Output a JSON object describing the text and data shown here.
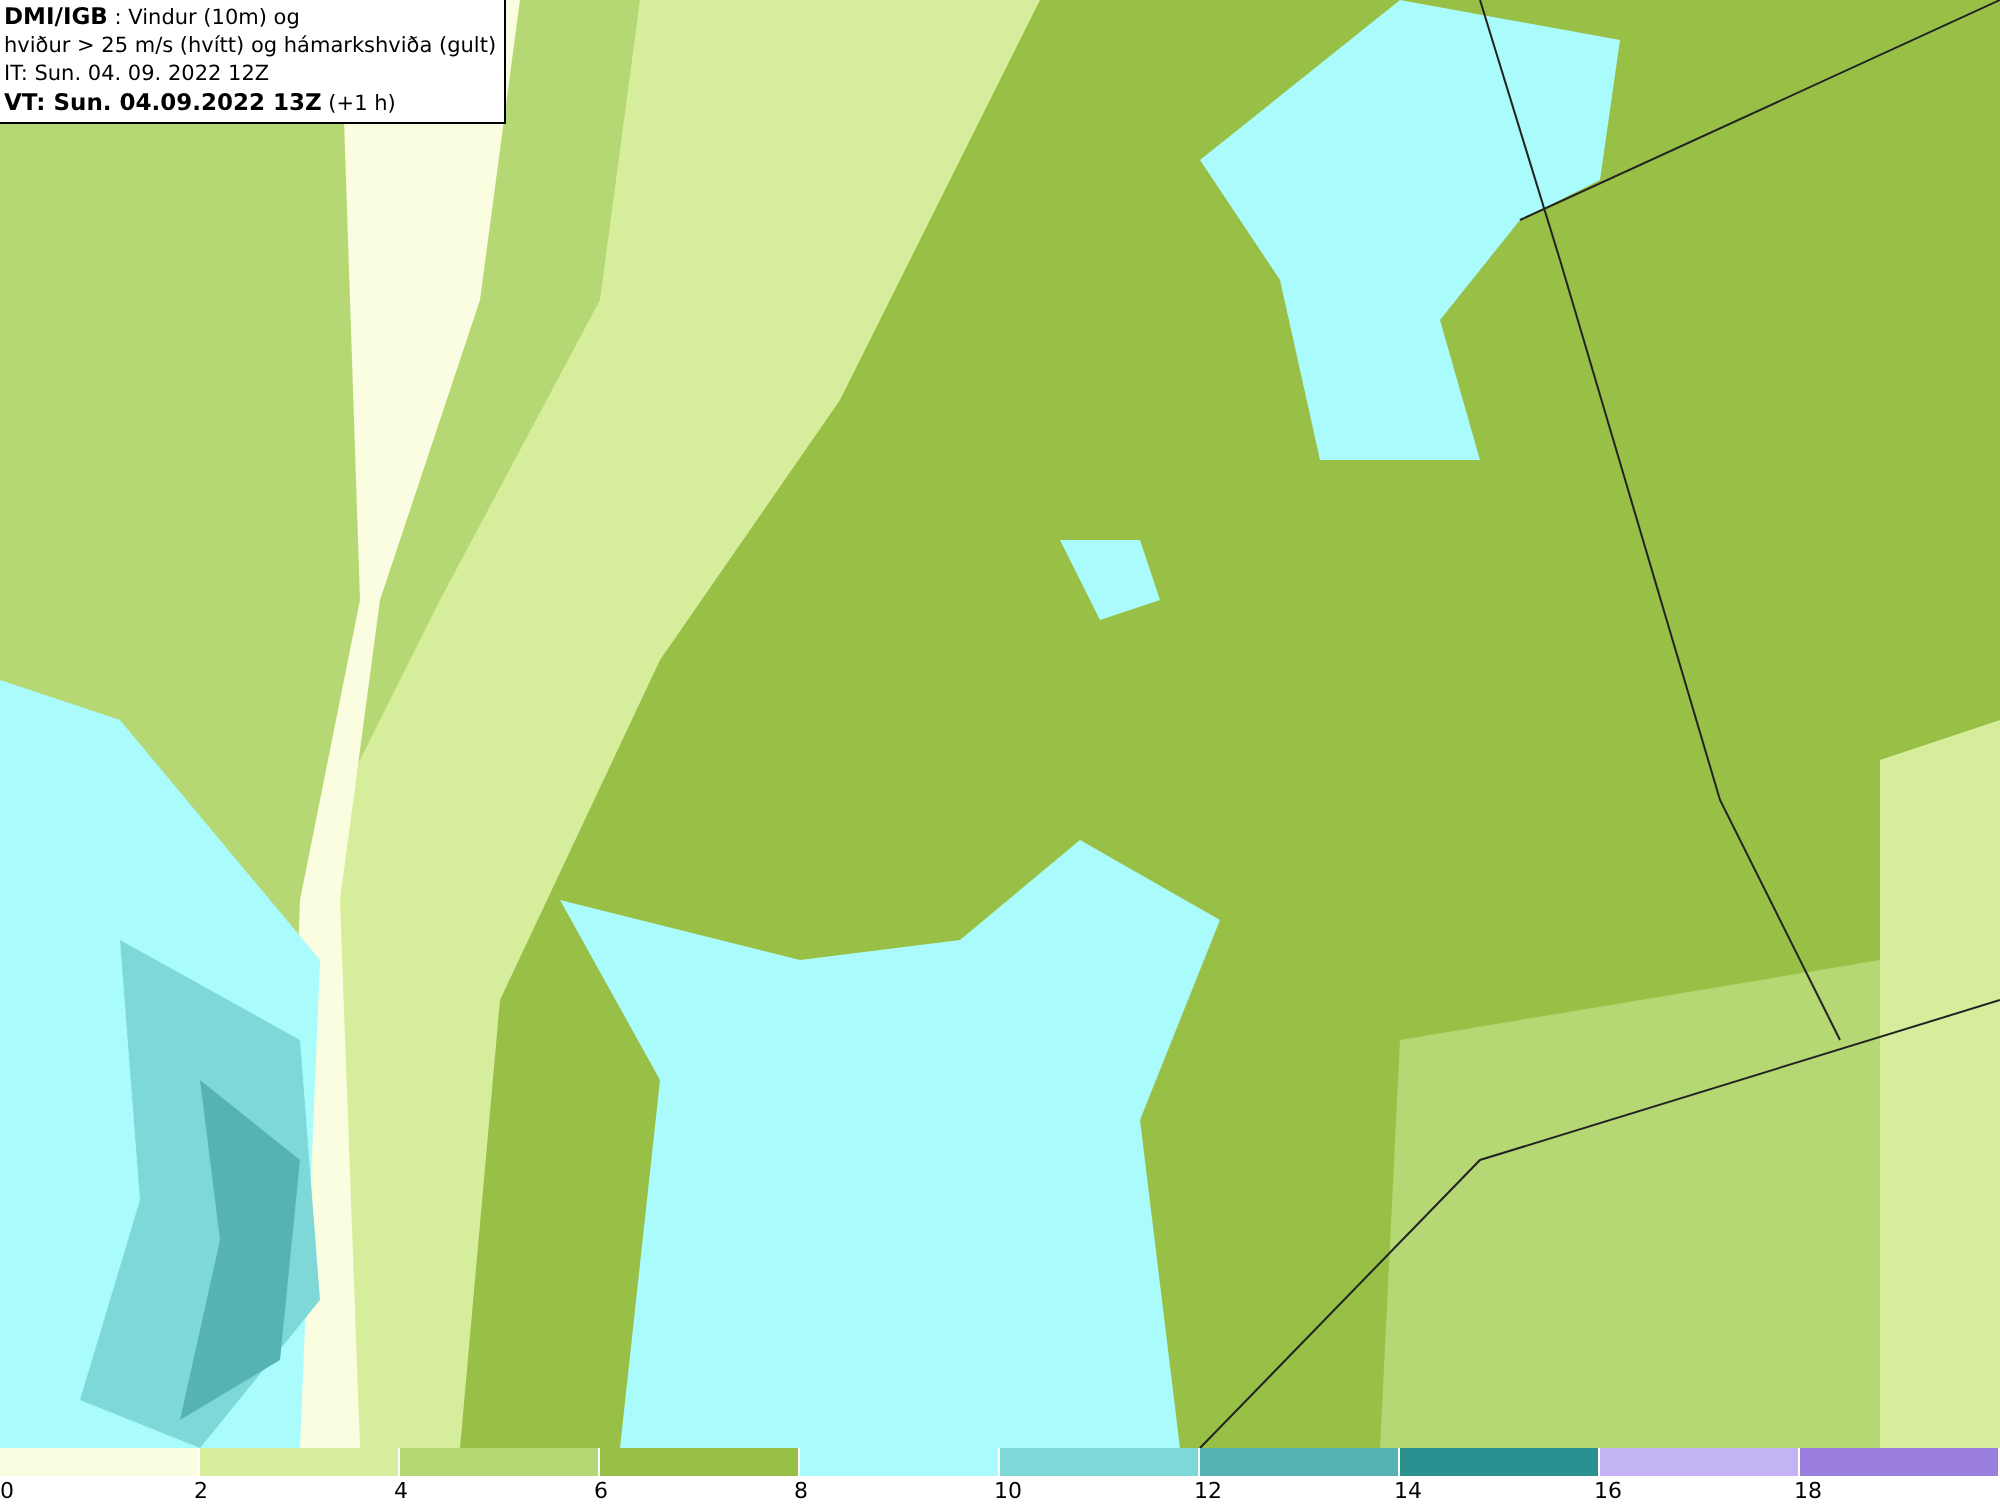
{
  "title_box": {
    "lines": [
      "**DMI/IGB** : Vindur (10m) og",
      "hviður > 25 m/s (hvítt) og hámarkshviða (gult)",
      "IT: Sun. 04. 09. 2022 12Z",
      "**VT: Sun. 04.09.2022 13Z** (+1 h)"
    ]
  },
  "legend": {
    "bins": [
      {
        "label": "0",
        "color": "#fbfde0"
      },
      {
        "label": "2",
        "color": "#d6ee9c"
      },
      {
        "label": "4",
        "color": "#b5d774"
      },
      {
        "label": "6",
        "color": "#98bf46"
      },
      {
        "label": "8",
        "color": "#aafbfb"
      },
      {
        "label": "10",
        "color": "#7fd8d8"
      },
      {
        "label": "12",
        "color": "#55b3b3"
      },
      {
        "label": "14",
        "color": "#2a9090"
      },
      {
        "label": "16",
        "color": "#c3b2f4"
      },
      {
        "label": "18",
        "color": "#9a7fdf"
      }
    ]
  }
}
